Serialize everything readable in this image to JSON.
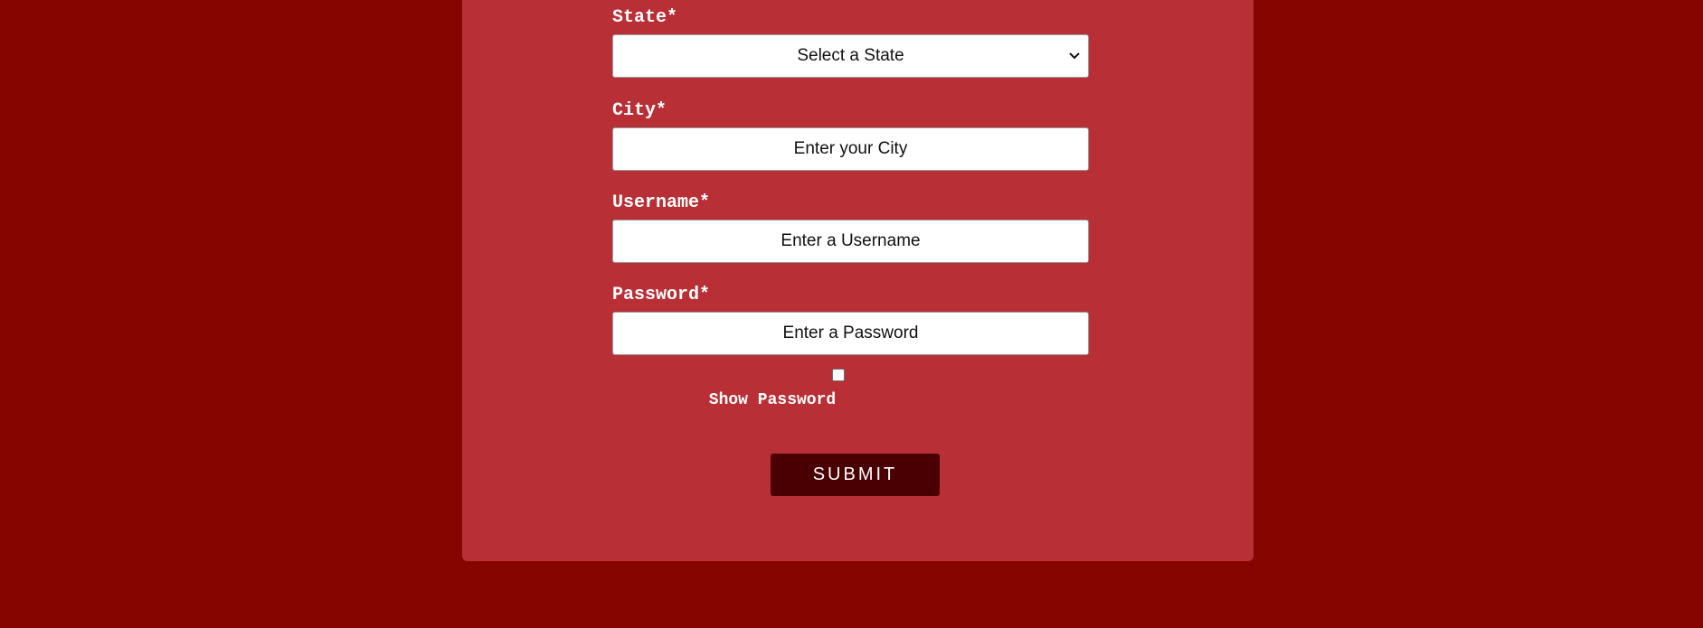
{
  "form": {
    "state": {
      "label": "State*",
      "selected": "Select a State"
    },
    "city": {
      "label": "City*",
      "placeholder": "Enter your City"
    },
    "username": {
      "label": "Username*",
      "placeholder": "Enter a Username"
    },
    "password": {
      "label": "Password*",
      "placeholder": "Enter a Password"
    },
    "show_password_label": "Show Password",
    "submit_label": "SUBMIT"
  },
  "colors": {
    "page_background": "#870500",
    "card_background": "#b92f36",
    "submit_background": "#4a0003"
  }
}
